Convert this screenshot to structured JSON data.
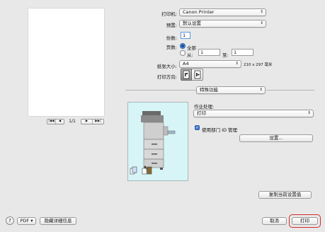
{
  "pager": {
    "first": "|◀◀",
    "prev": "◀",
    "page": "1/1",
    "next": "▶",
    "last": "▶▶|"
  },
  "fields": {
    "printer_label": "打印机:",
    "printer_value": "Canon Printer",
    "preset_label": "预置:",
    "preset_value": "默认设置",
    "copies_label": "份数:",
    "copies_value": "1",
    "pages_label": "页数:",
    "pages_all": "全部",
    "pages_from": "从:",
    "pages_from_value": "1",
    "pages_to": "至:",
    "pages_to_value": "1",
    "paper_label": "纸张大小:",
    "paper_value": "A4",
    "paper_dims": "210 x 297 毫米",
    "orientation_label": "打印方向:"
  },
  "section": {
    "selected": "特殊功能"
  },
  "job": {
    "label": "作业处理:",
    "value": "打印",
    "dept_checkbox": "使用部门 ID 管理",
    "dept_checked": true,
    "settings_button": "设置..."
  },
  "copy_defaults_button": "复制当前设置值",
  "footer": {
    "help": "?",
    "pdf": "PDF ▾",
    "hide_details": "隐藏详细信息",
    "cancel": "取消",
    "print": "打印"
  },
  "colors": {
    "accent_highlight": "#d42a2a",
    "printer_box_bg": "#d7f5f7"
  }
}
